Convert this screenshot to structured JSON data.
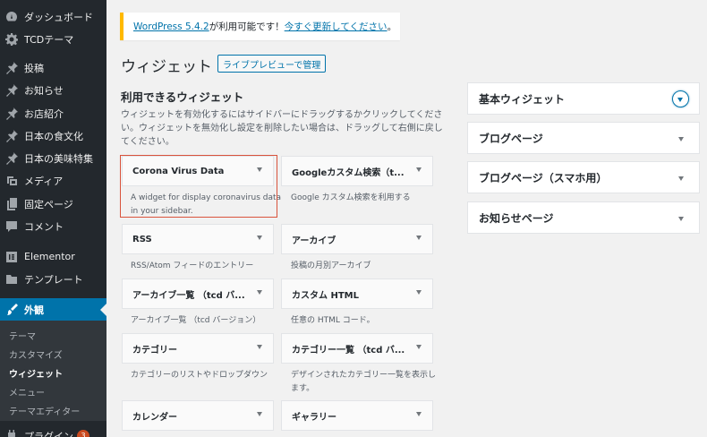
{
  "sidebar": {
    "items": [
      {
        "label": "ダッシュボード",
        "icon": "dashboard-icon"
      },
      {
        "label": "TCDテーマ",
        "icon": "gear-icon"
      },
      {
        "label": "投稿",
        "icon": "pin-icon"
      },
      {
        "label": "お知らせ",
        "icon": "pin-icon"
      },
      {
        "label": "お店紹介",
        "icon": "pin-icon"
      },
      {
        "label": "日本の食文化",
        "icon": "pin-icon"
      },
      {
        "label": "日本の美味特集",
        "icon": "pin-icon"
      },
      {
        "label": "メディア",
        "icon": "media-icon"
      },
      {
        "label": "固定ページ",
        "icon": "page-icon"
      },
      {
        "label": "コメント",
        "icon": "comment-icon"
      },
      {
        "label": "Elementor",
        "icon": "elementor-icon"
      },
      {
        "label": "テンプレート",
        "icon": "folder-icon"
      },
      {
        "label": "外観",
        "icon": "brush-icon"
      }
    ],
    "submenu": [
      "テーマ",
      "カスタマイズ",
      "ウィジェット",
      "メニュー",
      "テーマエディター"
    ],
    "plugins": {
      "label": "プラグイン",
      "badge": "3"
    }
  },
  "notice": {
    "link1": "WordPress 5.4.2",
    "text": " が利用可能です！",
    "link2": "今すぐ更新してください",
    "end": "。"
  },
  "page": {
    "title": "ウィジェット",
    "manage_live": "ライブプレビューで管理",
    "available_heading": "利用できるウィジェット",
    "available_desc": "ウィジェットを有効化するにはサイドバーにドラッグするかクリックしてください。ウィジェットを無効化し設定を削除したい場合は、ドラッグして右側に戻してください。"
  },
  "widgets": [
    {
      "title": "Corona Virus Data",
      "desc": "A widget for display coronavirus data in your sidebar."
    },
    {
      "title": "Googleカスタム検索（t...",
      "desc": "Google カスタム検索を利用する"
    },
    {
      "title": "RSS",
      "desc": "RSS/Atom フィードのエントリー"
    },
    {
      "title": "アーカイブ",
      "desc": "投稿の月別アーカイブ"
    },
    {
      "title": "アーカイブ一覧 （tcd バ...",
      "desc": "アーカイブ一覧 （tcd バージョン）"
    },
    {
      "title": "カスタム HTML",
      "desc": "任意の HTML コード。"
    },
    {
      "title": "カテゴリー",
      "desc": "カテゴリーのリストやドロップダウン"
    },
    {
      "title": "カテゴリー一覧 （tcd バ...",
      "desc": "デザインされたカテゴリー一覧を表示します。"
    },
    {
      "title": "カレンダー",
      "desc": ""
    },
    {
      "title": "ギャラリー",
      "desc": ""
    }
  ],
  "areas": [
    {
      "title": "基本ウィジェット"
    },
    {
      "title": "ブログページ"
    },
    {
      "title": "ブログページ（スマホ用）"
    },
    {
      "title": "お知らせページ"
    }
  ],
  "colors": {
    "accent": "#0073aa",
    "sidebar_bg": "#23282d",
    "notice_border": "#ffb900",
    "highlight": "#d9533c"
  }
}
